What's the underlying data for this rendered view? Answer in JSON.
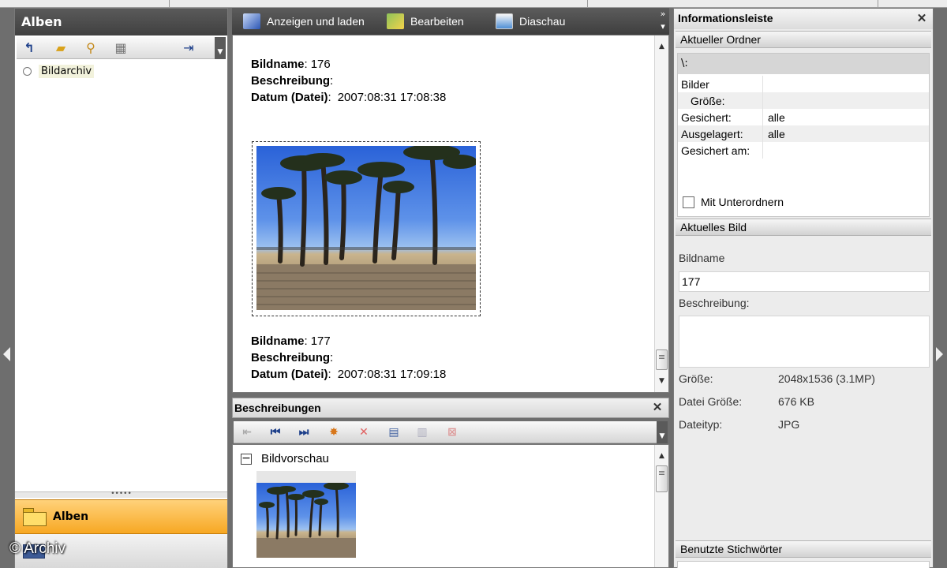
{
  "watermark": "© Archiv",
  "left_panel": {
    "title": "Alben",
    "tree": [
      {
        "label": "Bildarchiv"
      }
    ],
    "tabs": [
      {
        "label": "Alben"
      }
    ],
    "grip": "•••••"
  },
  "center": {
    "toolbar": {
      "items": [
        {
          "label": "Anzeigen und laden",
          "icon": "view-load-icon"
        },
        {
          "label": "Bearbeiten",
          "icon": "edit-icon"
        },
        {
          "label": "Diaschau",
          "icon": "slideshow-icon"
        }
      ],
      "more": "»"
    },
    "images": [
      {
        "name_label": "Bildname",
        "name": "176",
        "desc_label": "Beschreibung",
        "date_label": "Datum (Datei)",
        "date": "2007:08:31 17:08:38"
      },
      {
        "name_label": "Bildname",
        "name": "177",
        "desc_label": "Beschreibung",
        "date_label": "Datum (Datei)",
        "date": "2007:08:31 17:09:18"
      }
    ]
  },
  "descriptions": {
    "title": "Beschreibungen",
    "preview_label": "Bildvorschau",
    "collapse": "−"
  },
  "info": {
    "title": "Informationsleiste",
    "current_folder": {
      "title": "Aktueller Ordner",
      "path": "\\:",
      "rows": [
        {
          "key": "Bilder",
          "value": ""
        },
        {
          "key": "   Größe:",
          "value": ""
        },
        {
          "key": "Gesichert:",
          "value": "alle"
        },
        {
          "key": "Ausgelagert:",
          "value": "alle"
        },
        {
          "key": "Gesichert am:",
          "value": ""
        }
      ],
      "subfolders_label": "Mit Unterordnern"
    },
    "current_image": {
      "title": "Aktuelles Bild",
      "name_label": "Bildname",
      "name_value": "177",
      "desc_label": "Beschreibung:",
      "desc_value": "",
      "details": [
        {
          "key": "Größe:",
          "value": "2048x1536 (3.1MP)"
        },
        {
          "key": "Datei Größe:",
          "value": "676 KB"
        },
        {
          "key": "Dateityp:",
          "value": "JPG"
        }
      ]
    },
    "keywords_title": "Benutzte Stichwörter"
  },
  "colors": {
    "accent_tab": "#f7a823",
    "dark_toolbar": "#4a4a4a"
  }
}
